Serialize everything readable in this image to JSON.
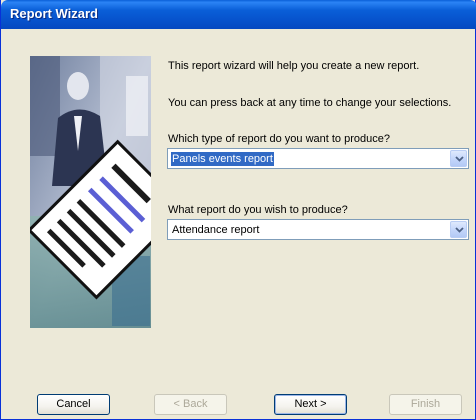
{
  "window": {
    "title": "Report Wizard"
  },
  "intro": {
    "line1": "This report wizard will help you create a new report.",
    "line2": "You can press back at any time to change your selections."
  },
  "report_type": {
    "label": "Which type of report do you want to produce?",
    "value": "Panels events report"
  },
  "report": {
    "label": "What report do you wish to produce?",
    "value": "Attendance report"
  },
  "buttons": {
    "cancel": "Cancel",
    "back": "< Back",
    "next": "Next >",
    "finish": "Finish"
  }
}
